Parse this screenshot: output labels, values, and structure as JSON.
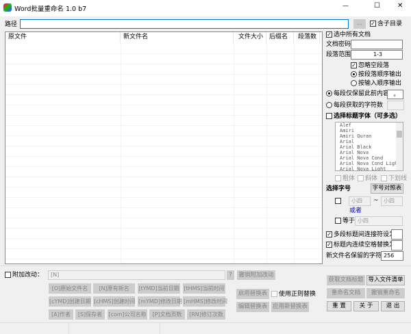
{
  "window": {
    "title": "Word批量重命名 1.0 b7",
    "minimize": "—",
    "maximize": "☐",
    "close": "✕"
  },
  "path": {
    "label": "路径",
    "value": "",
    "browse": "...",
    "include_subdirs": "含子目录",
    "include_subdirs_checked": true
  },
  "table": {
    "columns": [
      "原文件",
      "新文件名",
      "文件大小",
      "后缀名",
      "段落数"
    ],
    "rows": []
  },
  "options": {
    "select_all": "选中所有文档",
    "select_all_checked": true,
    "password_label": "文档密码",
    "password_value": "",
    "range_label": "段落范围",
    "range_value": "1-3",
    "ignore_empty": "忽略空段落",
    "ignore_empty_checked": true,
    "order_para": "按段落顺序输出",
    "order_input": "按输入顺序输出",
    "order_selected": "para",
    "keep_before": "每段仅保留此前内容",
    "keep_before_value": "。",
    "keep_before_selected": true,
    "char_count": "每段获取的字符数",
    "char_count_value": "",
    "font_select": "选择标题字体（可多选）",
    "font_select_checked": false,
    "fonts": [
      "Alef",
      "Amiri",
      "Amiri Quran",
      "Arial",
      "Arial Black",
      "Arial Nova",
      "Arial Nova Cond",
      "Arial Nova Cond Light",
      "Arial Nova Light"
    ],
    "bold": "粗体",
    "italic": "斜体",
    "underline": "下划线",
    "size_label": "选择字号",
    "size_table_btn": "字号对照表",
    "size_from": "小四",
    "tilde": "~",
    "size_to": "小四",
    "or": "或者",
    "equal_label": "等于",
    "equal_value": "小四",
    "joiner": "多段标题间连接符设为",
    "joiner_checked": true,
    "joiner_value": "",
    "space_replace": "标题内连续空格替换为",
    "space_replace_checked": true,
    "space_replace_value": "",
    "max_chars_label": "新文件名保留的字符数",
    "max_chars_value": "256"
  },
  "extra": {
    "label": "附加改动：",
    "value": "[N]",
    "help": "?",
    "undo": "撤销附加改动",
    "tags": [
      [
        "[O]原始文件名",
        "[N]原有新名",
        "[tYMD]当前日期",
        "[tHMS]当前时间"
      ],
      [
        "[cYMD]创建日期",
        "[cHMS]创建时间",
        "[mYMD]修改日期",
        "[mHMS]修改时间"
      ],
      [
        "[A]作者",
        "[S]保存者",
        "[com]公司名称",
        "[P]文档页数",
        "[RN]修订次数"
      ]
    ]
  },
  "replace": {
    "enable": "启用替换表",
    "regex": "使用正则替换",
    "edit": "编辑替换表",
    "apply": "应用新替换表"
  },
  "actions": {
    "get_titles": "获取文档标题",
    "import_list": "导入文件清单",
    "rename": "重命名文档",
    "undo_rename": "撤销重命名",
    "reset": "重 置",
    "about": "关 于",
    "exit": "退 出"
  },
  "colors": {
    "accent_blue": "#0000ff",
    "selection_border": "#0078d7"
  }
}
